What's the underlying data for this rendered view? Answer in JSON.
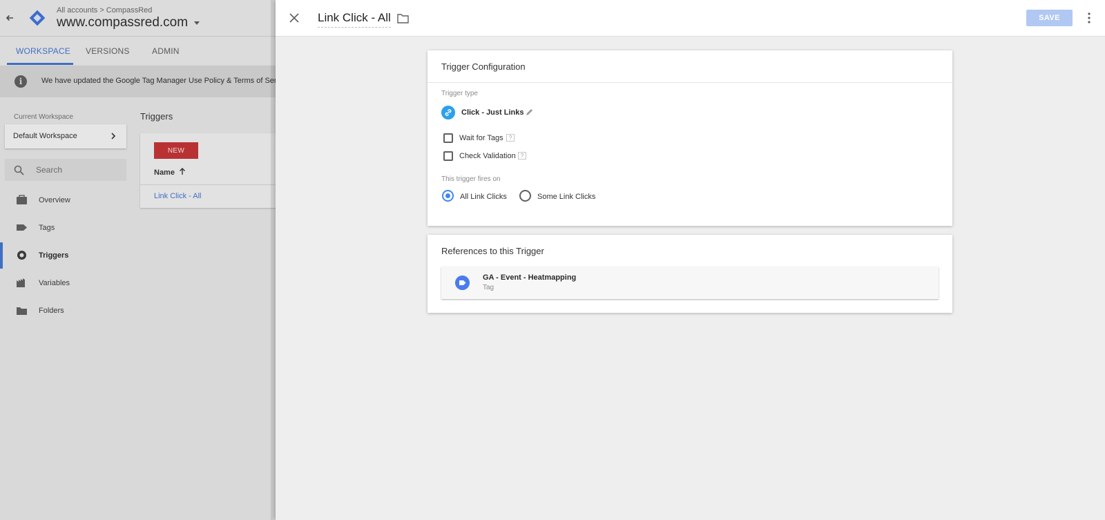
{
  "background": {
    "breadcrumb": {
      "root": "All accounts",
      "separator": ">",
      "account": "CompassRed"
    },
    "container_name": "www.compassred.com",
    "tabs": [
      {
        "label": "WORKSPACE"
      },
      {
        "label": "VERSIONS"
      },
      {
        "label": "ADMIN"
      }
    ],
    "notice_icon": "i",
    "notice_text": "We have updated the Google Tag Manager Use Policy & Terms of Service",
    "current_workspace_label": "Current Workspace",
    "workspace_name": "Default Workspace",
    "search": {
      "placeholder": "Search"
    },
    "nav": [
      {
        "label": "Overview",
        "icon": "briefcase-icon"
      },
      {
        "label": "Tags",
        "icon": "tag-icon"
      },
      {
        "label": "Triggers",
        "icon": "trigger-icon",
        "active": true
      },
      {
        "label": "Variables",
        "icon": "variables-icon"
      },
      {
        "label": "Folders",
        "icon": "folder-icon"
      }
    ],
    "triggers_title": "Triggers",
    "new_button": "NEW",
    "name_column": "Name",
    "trigger_rows": [
      {
        "name": "Link Click - All"
      }
    ]
  },
  "sheet": {
    "title": "Link Click - All",
    "save_label": "SAVE",
    "config": {
      "title": "Trigger Configuration",
      "trigger_type_label": "Trigger type",
      "trigger_type": "Click - Just Links",
      "checkboxes": [
        {
          "label": "Wait for Tags",
          "checked": false
        },
        {
          "label": "Check Validation",
          "checked": false
        }
      ],
      "help_glyph": "?",
      "fires_on_label": "This trigger fires on",
      "fires_on_options": [
        {
          "label": "All Link Clicks",
          "selected": true
        },
        {
          "label": "Some Link Clicks",
          "selected": false
        }
      ]
    },
    "references": {
      "title": "References to this Trigger",
      "items": [
        {
          "name": "GA - Event - Heatmapping",
          "type": "Tag"
        }
      ]
    }
  },
  "colors": {
    "accent_blue": "#4285f4",
    "link_blue": "#3f6fc4",
    "new_button_red": "#b83234",
    "save_button_disabled": "#b1c8f3",
    "trigger_type_icon": "#2ca0ea"
  }
}
